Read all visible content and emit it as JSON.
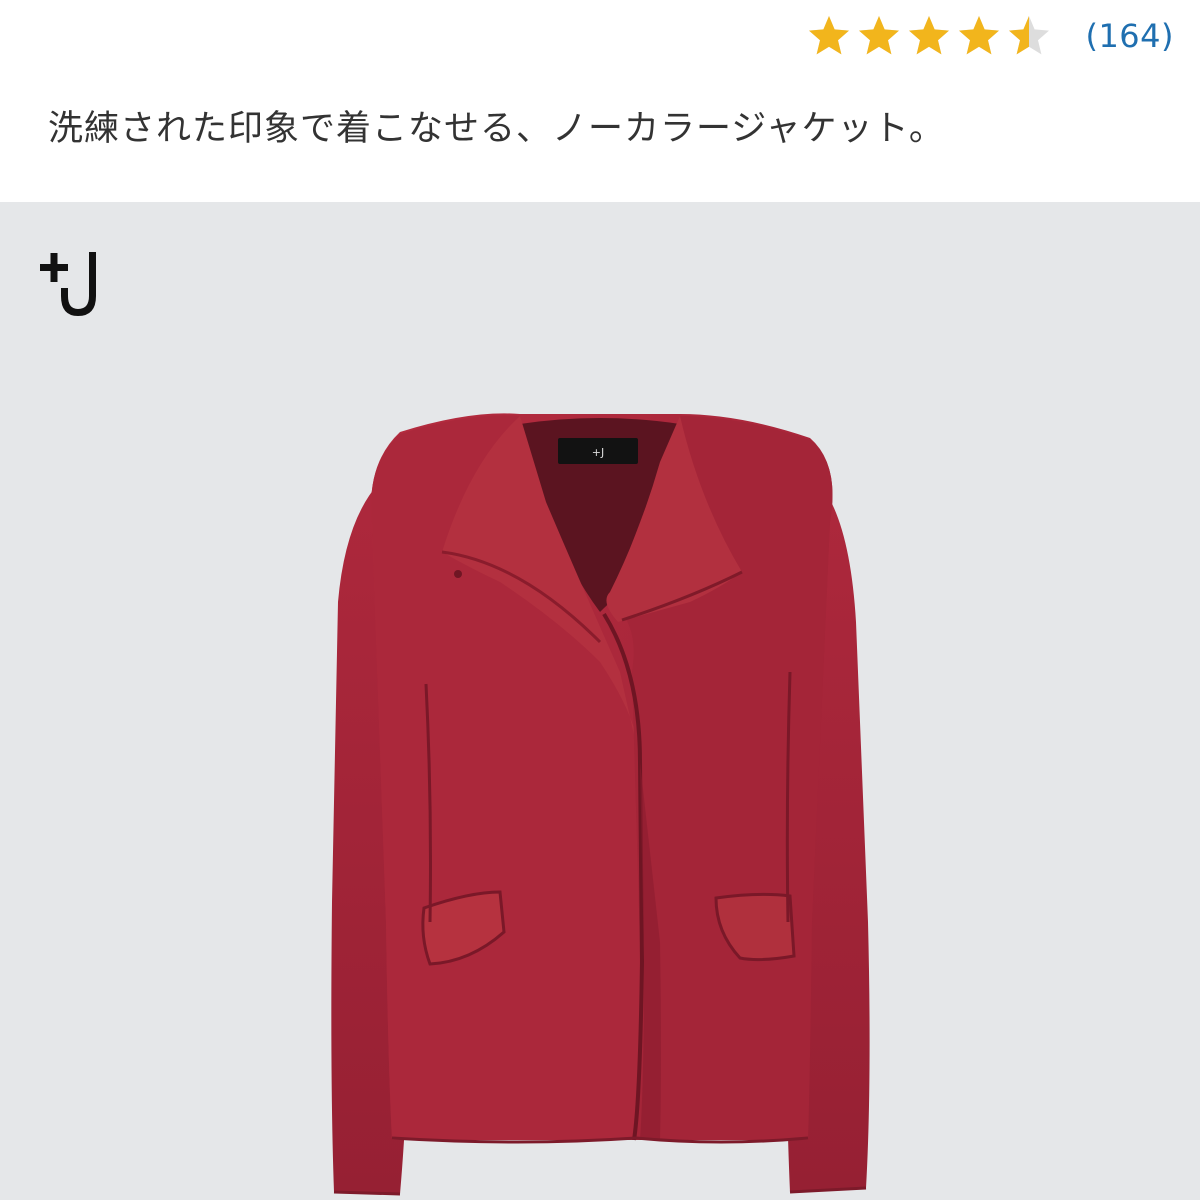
{
  "rating": {
    "value": 4.5,
    "max": 5,
    "count_label": "(164)",
    "star_color": "#f2b51c",
    "empty_star_color": "#dddddd"
  },
  "product": {
    "description": "洗練された印象で着こなせる、ノーカラージャケット。",
    "image_background": "#e5e7e9",
    "jacket_color": "#a8263a",
    "brand_logo_icon": "plus-j-logo-icon"
  }
}
